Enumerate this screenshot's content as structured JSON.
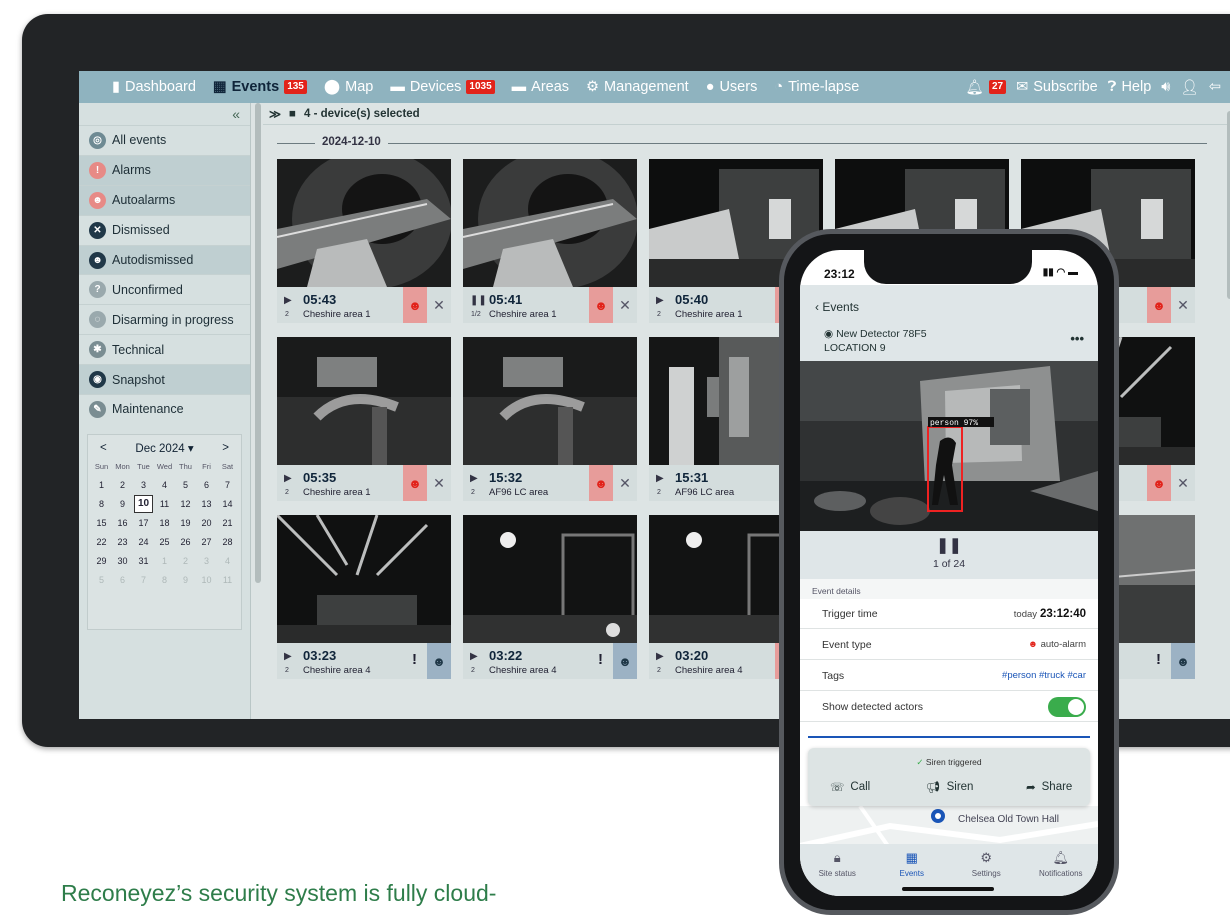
{
  "nav": {
    "items": [
      {
        "key": "dashboard",
        "label": "Dashboard",
        "icon": "bar-chart-icon"
      },
      {
        "key": "events",
        "label": "Events",
        "icon": "grid-icon",
        "badge": "135",
        "active": true
      },
      {
        "key": "map",
        "label": "Map",
        "icon": "map-pin-icon"
      },
      {
        "key": "devices",
        "label": "Devices",
        "icon": "folder-icon",
        "badge": "1035"
      },
      {
        "key": "areas",
        "label": "Areas",
        "icon": "folder-icon"
      },
      {
        "key": "management",
        "label": "Management",
        "icon": "gear-icon"
      },
      {
        "key": "users",
        "label": "Users",
        "icon": "user-icon"
      },
      {
        "key": "timelapse",
        "label": "Time-lapse",
        "icon": "timelapse-icon"
      }
    ],
    "notifications_badge": "27",
    "subscribe": "Subscribe",
    "help": "Help"
  },
  "sidebar": {
    "collapse": "«",
    "items": [
      {
        "label": "All events",
        "color": "#6e8a93",
        "glyph": "◎",
        "shade": false
      },
      {
        "label": "Alarms",
        "color": "#e78a86",
        "glyph": "!",
        "shade": true
      },
      {
        "label": "Autoalarms",
        "color": "#e78a86",
        "glyph": "☻",
        "shade": true
      },
      {
        "label": "Dismissed",
        "color": "#203848",
        "glyph": "✕",
        "shade": false
      },
      {
        "label": "Autodismissed",
        "color": "#203848",
        "glyph": "☻",
        "shade": true
      },
      {
        "label": "Unconfirmed",
        "color": "#9aa9ad",
        "glyph": "?",
        "shade": false
      },
      {
        "label": "Disarming in progress",
        "color": "#9aa9ad",
        "glyph": "◌",
        "shade": false
      },
      {
        "label": "Technical",
        "color": "#7a8d92",
        "glyph": "✱",
        "shade": false
      },
      {
        "label": "Snapshot",
        "color": "#203848",
        "glyph": "◉",
        "shade": true
      },
      {
        "label": "Maintenance",
        "color": "#7a8d92",
        "glyph": "✎",
        "shade": false
      }
    ]
  },
  "calendar": {
    "prev": "<",
    "next": ">",
    "month": "Dec 2024 ▾",
    "dow": [
      "Sun",
      "Mon",
      "Tue",
      "Wed",
      "Thu",
      "Fri",
      "Sat"
    ],
    "days": [
      {
        "d": "1"
      },
      {
        "d": "2"
      },
      {
        "d": "3"
      },
      {
        "d": "4"
      },
      {
        "d": "5"
      },
      {
        "d": "6"
      },
      {
        "d": "7"
      },
      {
        "d": "8"
      },
      {
        "d": "9"
      },
      {
        "d": "10",
        "sel": true
      },
      {
        "d": "11"
      },
      {
        "d": "12"
      },
      {
        "d": "13"
      },
      {
        "d": "14"
      },
      {
        "d": "15"
      },
      {
        "d": "16"
      },
      {
        "d": "17"
      },
      {
        "d": "18"
      },
      {
        "d": "19"
      },
      {
        "d": "20"
      },
      {
        "d": "21"
      },
      {
        "d": "22"
      },
      {
        "d": "23"
      },
      {
        "d": "24"
      },
      {
        "d": "25"
      },
      {
        "d": "26"
      },
      {
        "d": "27"
      },
      {
        "d": "28"
      },
      {
        "d": "29"
      },
      {
        "d": "30"
      },
      {
        "d": "31"
      },
      {
        "d": "1",
        "m": true
      },
      {
        "d": "2",
        "m": true
      },
      {
        "d": "3",
        "m": true
      },
      {
        "d": "4",
        "m": true
      },
      {
        "d": "5",
        "m": true
      },
      {
        "d": "6",
        "m": true
      },
      {
        "d": "7",
        "m": true
      },
      {
        "d": "8",
        "m": true
      },
      {
        "d": "9",
        "m": true
      },
      {
        "d": "10",
        "m": true
      },
      {
        "d": "11",
        "m": true
      }
    ]
  },
  "main": {
    "selection": "4 - device(s) selected",
    "date": "2024-12-10"
  },
  "events": [
    {
      "time": "05:43",
      "count": "2",
      "area": "Cheshire area 1",
      "kind": "red",
      "icon": "play",
      "scene": "tunnel"
    },
    {
      "time": "05:41",
      "count": "1/2",
      "area": "Cheshire area 1",
      "kind": "red",
      "icon": "pause",
      "scene": "tunnel"
    },
    {
      "time": "05:40",
      "count": "2",
      "area": "Cheshire area 1",
      "kind": "red",
      "icon": "play",
      "scene": "building"
    },
    {
      "time": "",
      "count": "",
      "area": "",
      "kind": "none",
      "icon": "",
      "scene": "building"
    },
    {
      "time": "",
      "count": "",
      "area": "",
      "kind": "red",
      "icon": "",
      "scene": "building"
    },
    {
      "time": "05:35",
      "count": "2",
      "area": "Cheshire area 1",
      "kind": "red",
      "icon": "play",
      "scene": "yard"
    },
    {
      "time": "15:32",
      "count": "2",
      "area": "AF96 LC area",
      "kind": "red",
      "icon": "play",
      "scene": "yard"
    },
    {
      "time": "15:31",
      "count": "2",
      "area": "AF96 LC area",
      "kind": "excl",
      "icon": "play",
      "scene": "container"
    },
    {
      "time": "",
      "count": "",
      "area": "",
      "kind": "none",
      "icon": "",
      "scene": "yard"
    },
    {
      "time": "",
      "count": "",
      "area": "",
      "kind": "red",
      "icon": "",
      "scene": "tree"
    },
    {
      "time": "03:23",
      "count": "2",
      "area": "Cheshire area 4",
      "kind": "blue",
      "icon": "play",
      "scene": "tree"
    },
    {
      "time": "03:22",
      "count": "2",
      "area": "Cheshire area 4",
      "kind": "blue",
      "icon": "play",
      "scene": "fence"
    },
    {
      "time": "03:20",
      "count": "2",
      "area": "Cheshire area 4",
      "kind": "red",
      "icon": "play",
      "scene": "fence"
    },
    {
      "time": "",
      "count": "",
      "area": "",
      "kind": "none",
      "icon": "",
      "scene": "fence"
    },
    {
      "time": "",
      "count": "",
      "area": "",
      "kind": "blue",
      "icon": "",
      "scene": "lake"
    }
  ],
  "phone": {
    "status_time": "23:12",
    "back": "Events",
    "detector": "New Detector 78F5",
    "location": "LOCATION 9",
    "more": "•••",
    "detection_label": "person  97%",
    "page": "1 of 24",
    "section": "Event details",
    "trigger_label": "Trigger time",
    "trigger_prefix": "today",
    "trigger_value": "23:12:40",
    "type_label": "Event type",
    "type_value": "auto-alarm",
    "tags_label": "Tags",
    "tags_value": "#person #truck #car",
    "actors_label": "Show detected actors",
    "siren_status": "Siren triggered",
    "call": "Call",
    "siren": "Siren",
    "share": "Share",
    "map_place": "Chelsea Old Town Hall",
    "tabs": [
      "Site status",
      "Events",
      "Settings",
      "Notifications"
    ]
  },
  "caption": "Reconeyez’s security system is fully cloud-",
  "colors": {
    "nav": "#8fb3bf",
    "alarm": "#e2231a",
    "toggle": "#3aac4c",
    "caption": "#2e7d4a"
  }
}
